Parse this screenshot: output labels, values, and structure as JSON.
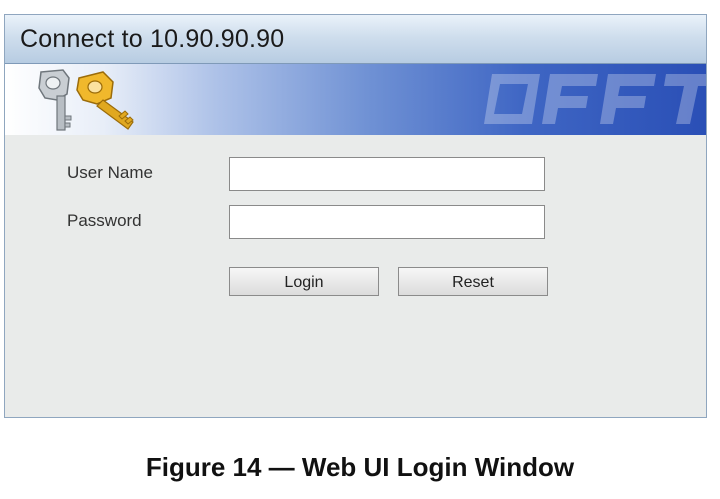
{
  "window": {
    "title": "Connect to 10.90.90.90"
  },
  "banner": {
    "icon": "keys-icon",
    "watermark": "brand-watermark"
  },
  "form": {
    "username_label": "User Name",
    "username_value": "",
    "password_label": "Password",
    "password_value": "",
    "login_button": "Login",
    "reset_button": "Reset"
  },
  "caption": "Figure 14 — Web UI Login Window",
  "colors": {
    "title_bar": "#cfdeed",
    "banner_dark": "#2a4fb6",
    "panel_bg": "#e9ebea",
    "key_gold": "#e0a820",
    "key_silver": "#b8bec4"
  }
}
